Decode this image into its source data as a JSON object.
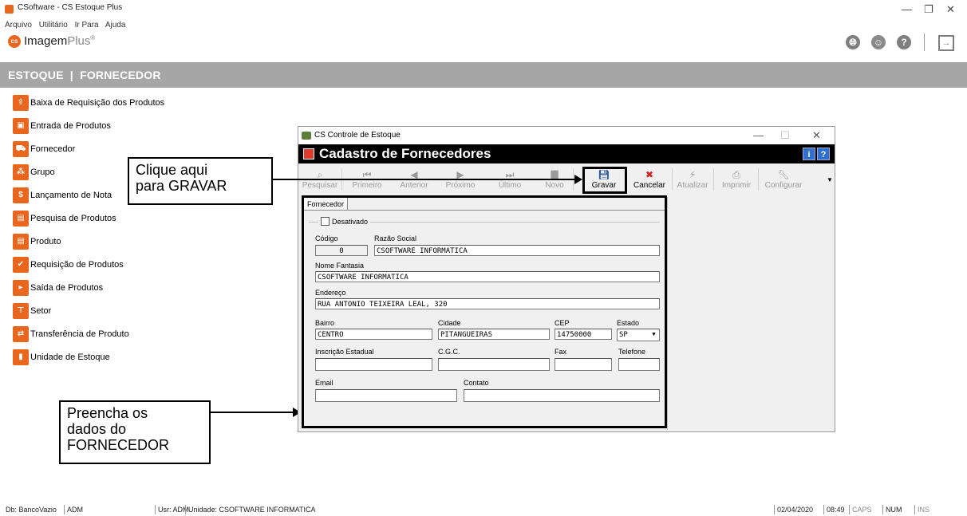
{
  "window": {
    "title": "CSoftware - CS Estoque Plus",
    "controls": {
      "minimize": "—",
      "restore": "❐",
      "close": "✕"
    }
  },
  "menubar": [
    "Arquivo",
    "Utilitário",
    "Ir Para",
    "Ajuda"
  ],
  "brand": {
    "name": "Imagem",
    "plus": "Plus",
    "reg": "®",
    "badge": "cs"
  },
  "module_title": "ESTOQUE  |  FORNECEDOR",
  "sidebar": [
    {
      "label": "Baixa de Requisição dos Produtos",
      "icon": "upload-box-icon"
    },
    {
      "label": "Entrada de Produtos",
      "icon": "gift-box-icon"
    },
    {
      "label": "Fornecedor",
      "icon": "truck-icon"
    },
    {
      "label": "Grupo",
      "icon": "group-icon"
    },
    {
      "label": "Lançamento de Nota",
      "icon": "money-icon"
    },
    {
      "label": "Pesquisa de Produtos",
      "icon": "database-icon"
    },
    {
      "label": "Produto",
      "icon": "database-icon"
    },
    {
      "label": "Requisição de Produtos",
      "icon": "check-doc-icon"
    },
    {
      "label": "Saída de Produtos",
      "icon": "exit-doc-icon"
    },
    {
      "label": "Setor",
      "icon": "org-chart-icon"
    },
    {
      "label": "Transferência de Produto",
      "icon": "transfer-icon"
    },
    {
      "label": "Unidade de Estoque",
      "icon": "unit-icon"
    }
  ],
  "callouts": {
    "save": "Clique aqui\npara GRAVAR",
    "fill": "Preencha os\ndados do\nFORNECEDOR"
  },
  "dialog": {
    "title": "CS Controle de Estoque",
    "header": "Cadastro de Fornecedores",
    "toolbar": [
      {
        "label": "Pesquisar",
        "icon": "binoculars-icon",
        "enabled": false
      },
      {
        "label": "Primeiro",
        "icon": "first-icon",
        "enabled": false
      },
      {
        "label": "Anterior",
        "icon": "prev-icon",
        "enabled": false
      },
      {
        "label": "Próximo",
        "icon": "next-icon",
        "enabled": false
      },
      {
        "label": "Último",
        "icon": "last-icon",
        "enabled": false
      },
      {
        "label": "Novo",
        "icon": "new-icon",
        "enabled": false
      },
      {
        "label": "Gravar",
        "icon": "save-icon",
        "enabled": true
      },
      {
        "label": "Cancelar",
        "icon": "cancel-icon",
        "enabled": true
      },
      {
        "label": "Atualizar",
        "icon": "refresh-icon",
        "enabled": false
      },
      {
        "label": "Imprimir",
        "icon": "print-icon",
        "enabled": false
      },
      {
        "label": "Configurar",
        "icon": "wrench-icon",
        "enabled": false
      }
    ],
    "tab": "Fornecedor",
    "form": {
      "desativado_label": "Desativado",
      "codigo_label": "Código",
      "codigo": "0",
      "razao_label": "Razão Social",
      "razao": "CSOFTWARE INFORMATICA",
      "fantasia_label": "Nome Fantasia",
      "fantasia": "CSOFTWARE INFORMATICA",
      "endereco_label": "Endereço",
      "endereco": "RUA ANTONIO TEIXEIRA LEAL, 320",
      "bairro_label": "Bairro",
      "bairro": "CENTRO",
      "cidade_label": "Cidade",
      "cidade": "PITANGUEIRAS",
      "cep_label": "CEP",
      "cep": "14750000",
      "estado_label": "Estado",
      "estado": "SP",
      "ie_label": "Inscrição Estadual",
      "ie": "",
      "cgc_label": "C.G.C.",
      "cgc": "",
      "fax_label": "Fax",
      "fax": "",
      "telefone_label": "Telefone",
      "telefone": "",
      "email_label": "Email",
      "email": "",
      "contato_label": "Contato",
      "contato": ""
    }
  },
  "statusbar": {
    "db": "Db: BancoVazio",
    "user1": "ADM",
    "usr": "Usr: ADM",
    "unidade": "Unidade: CSOFTWARE INFORMATICA",
    "date": "02/04/2020",
    "time": "08:49",
    "caps": "CAPS",
    "num": "NUM",
    "ins": "INS"
  }
}
